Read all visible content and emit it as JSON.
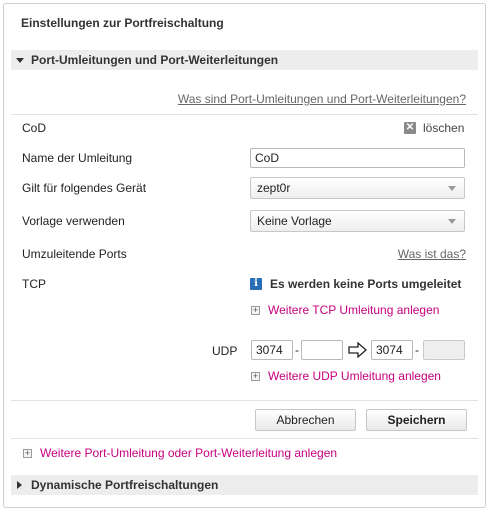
{
  "page_title": "Einstellungen zur Portfreischaltung",
  "section1": {
    "title": "Port-Umleitungen und Port-Weiterleitungen",
    "help_link": "Was sind Port-Umleitungen und Port-Weiterleitungen?"
  },
  "rule": {
    "name_heading": "CoD",
    "delete_label": "löschen",
    "fields": {
      "name_label": "Name der Umleitung",
      "name_value": "CoD",
      "device_label": "Gilt für folgendes Gerät",
      "device_value": "zept0r",
      "template_label": "Vorlage verwenden",
      "template_value": "Keine Vorlage"
    },
    "ports_label": "Umzuleitende Ports",
    "ports_help": "Was ist das?",
    "tcp": {
      "label": "TCP",
      "info": "Es werden keine Ports umgeleitet",
      "add": "Weitere TCP Umleitung anlegen"
    },
    "udp": {
      "label": "UDP",
      "from_start": "3074",
      "from_end": "",
      "to_start": "3074",
      "to_end": "",
      "dash": "-",
      "add": "Weitere UDP Umleitung anlegen"
    },
    "buttons": {
      "cancel": "Abbrechen",
      "save": "Speichern"
    }
  },
  "add_rule": "Weitere Port-Umleitung oder Port-Weiterleitung anlegen",
  "section2": {
    "title": "Dynamische Portfreischaltungen"
  },
  "colors": {
    "accent_link": "#c6007e",
    "info_icon": "#2a6fb5",
    "section_bar": "#ededed"
  }
}
